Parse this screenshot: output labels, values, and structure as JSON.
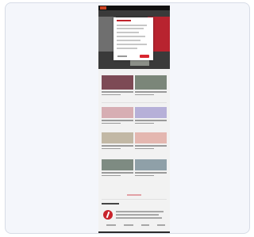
{
  "page": {
    "hero_colors": {
      "topbar": "#111111",
      "accent": "#b8232f",
      "button": "#d8262f"
    }
  },
  "grid": {
    "rows": [
      {
        "tiles": [
          {
            "color": "#a44d5a"
          },
          {
            "color": "#7f8a96"
          }
        ]
      },
      {
        "tiles": [
          {
            "color": "#d7aeb3"
          },
          {
            "color": "#b6b0d8"
          }
        ]
      },
      {
        "tiles": [
          {
            "color": "#c2b8a5"
          },
          {
            "color": "#e4b7b0"
          }
        ]
      },
      {
        "tiles": [
          {
            "color": "#7e8b82"
          },
          {
            "color": "#8fa0a8"
          }
        ]
      }
    ]
  },
  "footer": {
    "logo_color": "#c8232c"
  }
}
